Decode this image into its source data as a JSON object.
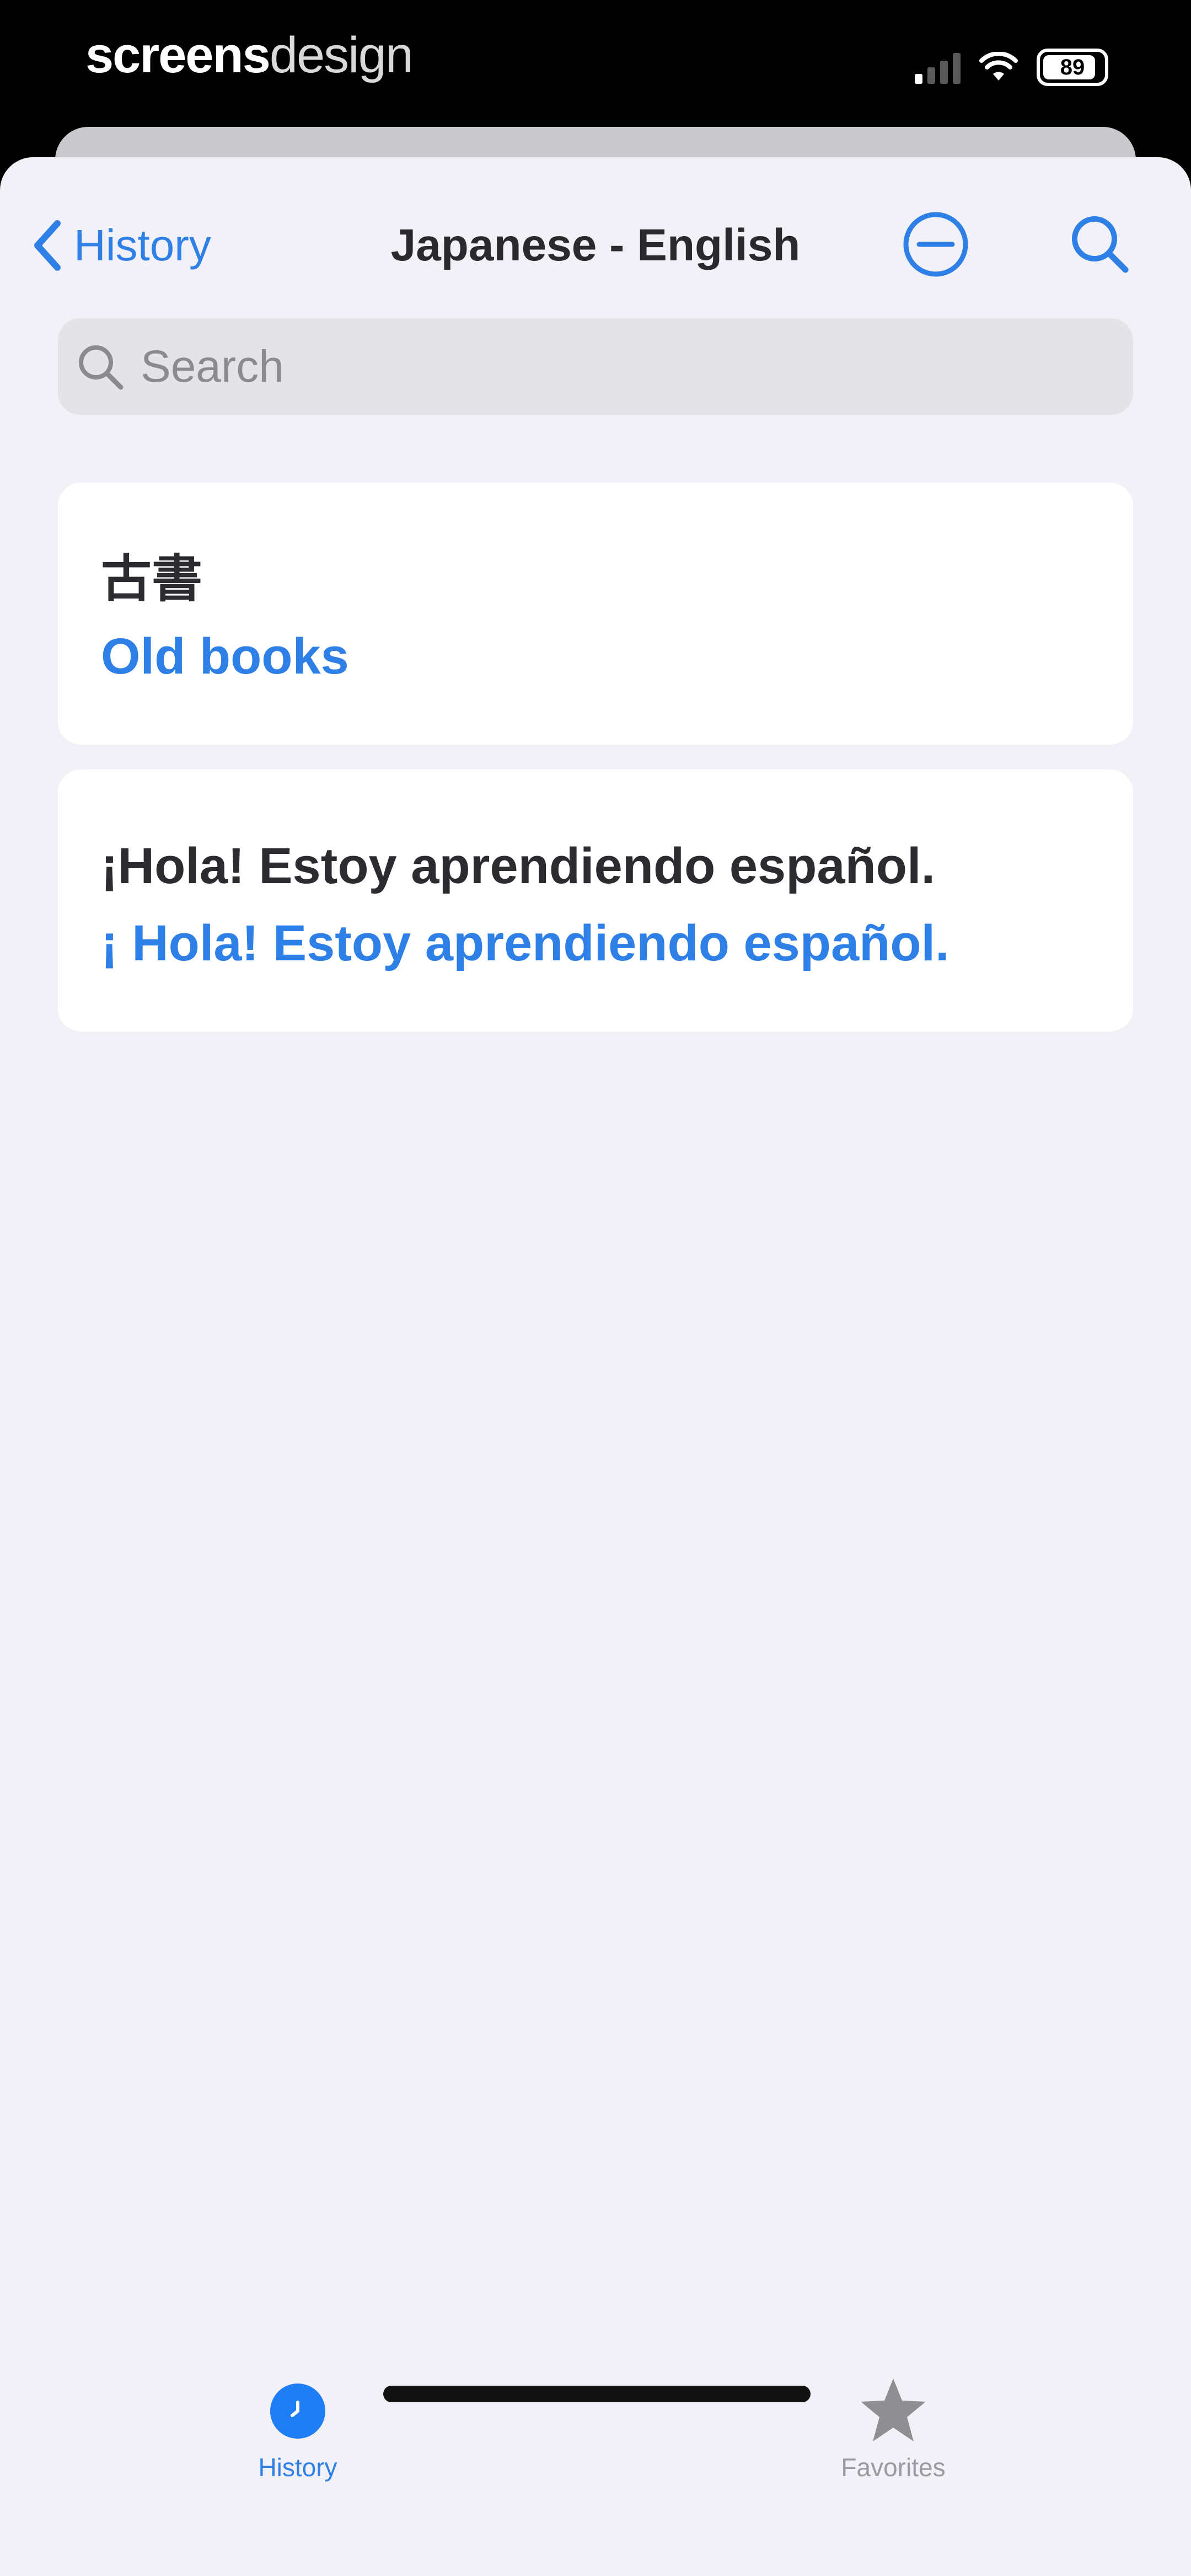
{
  "status_bar": {
    "brand_bold": "screens",
    "brand_light": "design",
    "battery": "89",
    "battery_level": 0.89
  },
  "nav": {
    "back_label": "History",
    "title": "Japanese - English",
    "clear_icon": "minus-circle-icon",
    "search_icon": "magnifier-icon"
  },
  "search": {
    "placeholder": "Search",
    "value": ""
  },
  "history": [
    {
      "source": "古書",
      "translation": "Old books"
    },
    {
      "source": "¡Hola! Estoy aprendiendo español.",
      "translation": "¡ Hola! Estoy aprendiendo español."
    }
  ],
  "tabs": [
    {
      "label": "History",
      "icon": "history-clock-icon",
      "active": true
    },
    {
      "label": "Favorites",
      "icon": "star-icon",
      "active": false
    }
  ],
  "colors": {
    "accent": "#2f80e6",
    "background": "#f1f1f7",
    "card": "#ffffff",
    "text": "#2c2c30"
  }
}
